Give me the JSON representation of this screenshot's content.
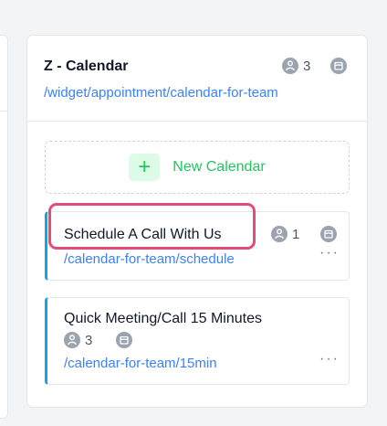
{
  "group": {
    "title": "Z - Calendar",
    "link": "/widget/appointment/calendar-for-team",
    "member_count": "3",
    "member_icon": "person-icon",
    "calendar_icon": "calendar-icon"
  },
  "new_calendar": {
    "plus": "+",
    "label": "New Calendar"
  },
  "calendars": [
    {
      "title": "Schedule A Call With Us",
      "link": "/calendar-for-team/schedule",
      "member_count": "1",
      "menu": "···"
    },
    {
      "title": "Quick Meeting/Call 15 Minutes",
      "link": "/calendar-for-team/15min",
      "member_count": "3",
      "menu": "···"
    }
  ],
  "colors": {
    "accent_link": "#3b82f6",
    "success": "#22c55e",
    "card_stripe": "#0ea5e9",
    "highlight": "#e34b7a"
  }
}
